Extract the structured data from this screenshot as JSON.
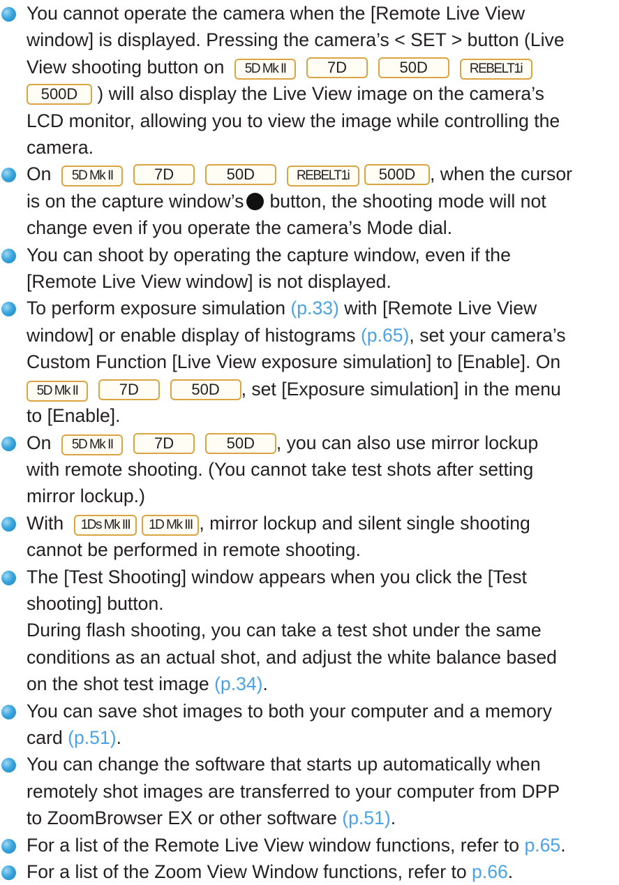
{
  "badges": {
    "m5d2": "5D Mk II",
    "d7": "7D",
    "d50": "50D",
    "rebel": "REBELT1i",
    "d500": "500D",
    "ds1m3": "1Ds Mk III",
    "d1m3": "1D Mk III"
  },
  "notes": [
    {
      "l1": "You cannot operate the camera when the [Remote Live View",
      "l2": "window] is displayed. Pressing the camera’s < SET > button (Live",
      "l3": "View shooting button on",
      "l5": ") will also display the Live View image on the camera’s",
      "l6": "LCD monitor, allowing you to view the image while controlling the",
      "l7": "camera."
    },
    {
      "l1a": "On",
      "l1b": ", when the cursor",
      "l2a": "is on the capture window’s",
      "l2b": "button, the shooting mode will not",
      "l3": "change even if you operate the camera’s Mode dial."
    },
    {
      "l1": "You can shoot by operating the capture window, even if the",
      "l2": "[Remote Live View window] is not displayed."
    },
    {
      "l1a": "To perform exposure simulation",
      "link1": "(p.33)",
      "l1b": "with [Remote Live View",
      "l2a": "window] or enable display of histograms",
      "link2": "(p.65)",
      "l2b": ", set your camera’s",
      "l3": "Custom Function [Live View exposure simulation] to [Enable]. On",
      "l4b": ", set [Exposure simulation] in the menu",
      "l5": "to [Enable]."
    },
    {
      "l1a": "On",
      "l1b": ", you can also use mirror lockup",
      "l2": "with remote shooting. (You cannot take test shots after setting",
      "l3": "mirror lockup.)"
    },
    {
      "l1a": "With",
      "l1b": ", mirror lockup and silent single shooting",
      "l2": "cannot be performed in remote shooting."
    },
    {
      "l1": "The [Test Shooting] window appears when you click the [Test",
      "l2": "shooting] button.",
      "l3": "During flash shooting, you can take a test shot under the same",
      "l4": "conditions as an actual shot, and adjust the white balance based",
      "l5a": "on the shot test image",
      "link": "(p.34)",
      "l5b": "."
    },
    {
      "l1": "You can save shot images to both your computer and a memory",
      "l2a": "card",
      "link": "(p.51)",
      "l2b": "."
    },
    {
      "l1": "You can change the software that starts up automatically when",
      "l2": "remotely shot images are transferred to your computer from DPP",
      "l3a": "to ZoomBrowser EX or other software",
      "link": "(p.51)",
      "l3b": "."
    },
    {
      "l1a": "For a list of the Remote Live View window functions, refer to",
      "link": "p.65",
      "l1b": "."
    },
    {
      "l1a": "For a list of the Zoom View Window functions, refer to",
      "link": "p.66",
      "l1b": "."
    }
  ],
  "colors": {
    "bullet": "#3aa6dd",
    "link": "#4aa3e6",
    "badge_border": "#d9a441",
    "text": "#231f20"
  },
  "icons": {
    "bullet": "blue-circle-bullet-icon",
    "shoot": "black-shoot-button-icon"
  }
}
